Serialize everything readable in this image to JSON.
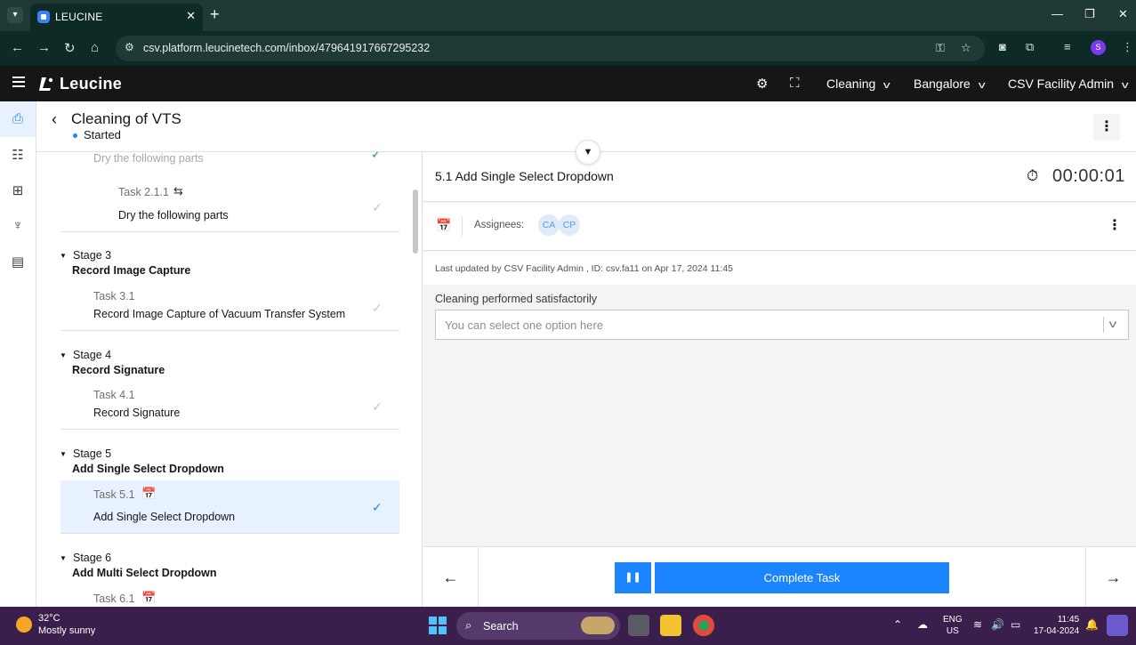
{
  "browser": {
    "tab_title": "LEUCINE",
    "url": "csv.platform.leucinetech.com/inbox/479641917667295232",
    "profile_initial": "S"
  },
  "app": {
    "brand": "Leucine",
    "dropdowns": {
      "use_case": "Cleaning",
      "facility": "Bangalore",
      "user": "CSV Facility Admin"
    }
  },
  "job": {
    "title": "Cleaning of VTS",
    "status": "Started"
  },
  "tasklist": {
    "partial_task_name": "Dry the following parts",
    "task_2_1_1": {
      "no": "Task 2.1.1",
      "name": "Dry the following parts"
    },
    "stages": [
      {
        "no": "Stage 3",
        "name": "Record Image Capture",
        "task_no": "Task 3.1",
        "task_name": "Record Image Capture of Vacuum Transfer System"
      },
      {
        "no": "Stage 4",
        "name": "Record Signature",
        "task_no": "Task 4.1",
        "task_name": "Record Signature"
      },
      {
        "no": "Stage 5",
        "name": "Add Single Select Dropdown",
        "task_no": "Task 5.1",
        "task_name": "Add Single Select Dropdown"
      },
      {
        "no": "Stage 6",
        "name": "Add Multi Select Dropdown",
        "task_no": "Task 6.1",
        "task_name": ""
      }
    ]
  },
  "task_panel": {
    "title": "5.1 Add Single Select Dropdown",
    "timer": "00:00:01",
    "assignees_label": "Assignees:",
    "assignees": [
      "CA",
      "CP"
    ],
    "last_updated": "Last updated by CSV Facility Admin , ID: csv.fa11 on Apr 17, 2024 11:45",
    "field_label": "Cleaning performed satisfactorily",
    "select_placeholder": "You can select one option here"
  },
  "footer": {
    "complete_label": "Complete Task"
  },
  "taskbar": {
    "temperature": "32°C",
    "condition": "Mostly sunny",
    "search_label": "Search",
    "lang_1": "ENG",
    "lang_2": "US",
    "time": "11:45",
    "date": "17-04-2024"
  },
  "colors": {
    "primary": "#1d84ff",
    "header_bg": "#161616",
    "active_row": "#e8f1ff"
  }
}
